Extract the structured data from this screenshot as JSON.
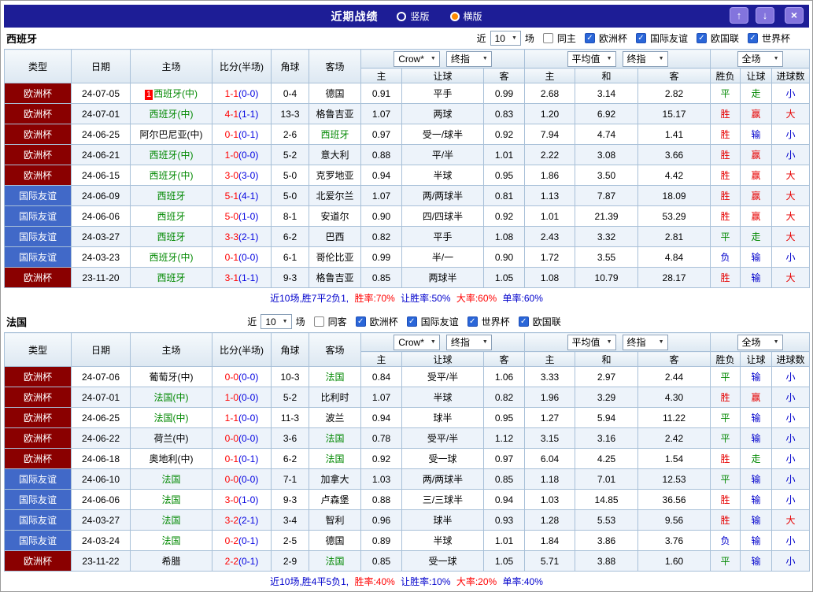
{
  "topbar": {
    "title": "近期战绩",
    "radio_vertical": "竖版",
    "radio_horizontal": "横版",
    "selected": "横版"
  },
  "icons": {
    "up_arrow": "↑",
    "down_arrow": "↓",
    "close": "×",
    "dropdown": "▼",
    "check": "✓"
  },
  "columns": {
    "type": "类型",
    "date": "日期",
    "home": "主场",
    "score": "比分(半场)",
    "corners": "角球",
    "away": "客场",
    "ah": {
      "bookmaker": "Crow*",
      "stage": "终指",
      "home": "主",
      "line": "让球",
      "away": "客"
    },
    "eu": {
      "label": "平均值",
      "stage": "终指",
      "home": "主",
      "draw": "和",
      "away": "客"
    },
    "result": {
      "label": "全场",
      "wdl": "胜负",
      "ah": "让球",
      "ou": "进球数"
    }
  },
  "type_styles": {
    "欧洲杯": "#8a0000",
    "国际友谊": "#4169c8"
  },
  "result_colors": {
    "胜": "#e60000",
    "平": "#008800",
    "负": "#0000cc",
    "赢": "#e60000",
    "走": "#008800",
    "输": "#0000cc",
    "大": "#e60000",
    "小": "#0000cc"
  },
  "sections": [
    {
      "team": "西班牙",
      "filter": {
        "prefix": "近",
        "count": "10",
        "suffix": "场",
        "same_label": "同主",
        "same_checked": false,
        "comps": [
          {
            "label": "欧洲杯",
            "checked": true
          },
          {
            "label": "国际友谊",
            "checked": true
          },
          {
            "label": "欧国联",
            "checked": true
          },
          {
            "label": "世界杯",
            "checked": true
          }
        ]
      },
      "rows": [
        {
          "type": "欧洲杯",
          "date": "24-07-05",
          "home": {
            "text": "西班牙(中)",
            "green": true,
            "badge": "1"
          },
          "score": "1-1",
          "half": "(0-0)",
          "corners": "0-4",
          "away": {
            "text": "德国"
          },
          "ah": [
            "0.91",
            "平手",
            "0.99"
          ],
          "eu": [
            "2.68",
            "3.14",
            "2.82"
          ],
          "res": [
            "平",
            "走",
            "小"
          ]
        },
        {
          "type": "欧洲杯",
          "date": "24-07-01",
          "home": {
            "text": "西班牙(中)",
            "green": true
          },
          "score": "4-1",
          "half": "(1-1)",
          "corners": "13-3",
          "away": {
            "text": "格鲁吉亚"
          },
          "ah": [
            "1.07",
            "两球",
            "0.83"
          ],
          "eu": [
            "1.20",
            "6.92",
            "15.17"
          ],
          "res": [
            "胜",
            "赢",
            "大"
          ]
        },
        {
          "type": "欧洲杯",
          "date": "24-06-25",
          "home": {
            "text": "阿尔巴尼亚(中)"
          },
          "score": "0-1",
          "half": "(0-1)",
          "corners": "2-6",
          "away": {
            "text": "西班牙",
            "green": true
          },
          "ah": [
            "0.97",
            "受一/球半",
            "0.92"
          ],
          "eu": [
            "7.94",
            "4.74",
            "1.41"
          ],
          "res": [
            "胜",
            "输",
            "小"
          ]
        },
        {
          "type": "欧洲杯",
          "date": "24-06-21",
          "home": {
            "text": "西班牙(中)",
            "green": true
          },
          "score": "1-0",
          "half": "(0-0)",
          "corners": "5-2",
          "away": {
            "text": "意大利"
          },
          "ah": [
            "0.88",
            "平/半",
            "1.01"
          ],
          "eu": [
            "2.22",
            "3.08",
            "3.66"
          ],
          "res": [
            "胜",
            "赢",
            "小"
          ]
        },
        {
          "type": "欧洲杯",
          "date": "24-06-15",
          "home": {
            "text": "西班牙(中)",
            "green": true
          },
          "score": "3-0",
          "half": "(3-0)",
          "corners": "5-0",
          "away": {
            "text": "克罗地亚"
          },
          "ah": [
            "0.94",
            "半球",
            "0.95"
          ],
          "eu": [
            "1.86",
            "3.50",
            "4.42"
          ],
          "res": [
            "胜",
            "赢",
            "大"
          ]
        },
        {
          "type": "国际友谊",
          "date": "24-06-09",
          "home": {
            "text": "西班牙",
            "green": true
          },
          "score": "5-1",
          "half": "(4-1)",
          "corners": "5-0",
          "away": {
            "text": "北爱尔兰"
          },
          "ah": [
            "1.07",
            "两/两球半",
            "0.81"
          ],
          "eu": [
            "1.13",
            "7.87",
            "18.09"
          ],
          "res": [
            "胜",
            "赢",
            "大"
          ]
        },
        {
          "type": "国际友谊",
          "date": "24-06-06",
          "home": {
            "text": "西班牙",
            "green": true
          },
          "score": "5-0",
          "half": "(1-0)",
          "corners": "8-1",
          "away": {
            "text": "安道尔"
          },
          "ah": [
            "0.90",
            "四/四球半",
            "0.92"
          ],
          "eu": [
            "1.01",
            "21.39",
            "53.29"
          ],
          "res": [
            "胜",
            "赢",
            "大"
          ]
        },
        {
          "type": "国际友谊",
          "date": "24-03-27",
          "home": {
            "text": "西班牙",
            "green": true
          },
          "score": "3-3",
          "half": "(2-1)",
          "corners": "6-2",
          "away": {
            "text": "巴西"
          },
          "ah": [
            "0.82",
            "平手",
            "1.08"
          ],
          "eu": [
            "2.43",
            "3.32",
            "2.81"
          ],
          "res": [
            "平",
            "走",
            "大"
          ]
        },
        {
          "type": "国际友谊",
          "date": "24-03-23",
          "home": {
            "text": "西班牙(中)",
            "green": true
          },
          "score": "0-1",
          "half": "(0-0)",
          "corners": "6-1",
          "away": {
            "text": "哥伦比亚"
          },
          "ah": [
            "0.99",
            "半/一",
            "0.90"
          ],
          "eu": [
            "1.72",
            "3.55",
            "4.84"
          ],
          "res": [
            "负",
            "输",
            "小"
          ]
        },
        {
          "type": "欧洲杯",
          "date": "23-11-20",
          "home": {
            "text": "西班牙",
            "green": true
          },
          "score": "3-1",
          "half": "(1-1)",
          "corners": "9-3",
          "away": {
            "text": "格鲁吉亚"
          },
          "ah": [
            "0.85",
            "两球半",
            "1.05"
          ],
          "eu": [
            "1.08",
            "10.79",
            "28.17"
          ],
          "res": [
            "胜",
            "输",
            "大"
          ]
        }
      ],
      "summary": [
        {
          "text": "近10场,胜7平2负1, ",
          "color": "#0000cc"
        },
        {
          "text": "胜率:70% ",
          "color": "#ff0000"
        },
        {
          "text": "让胜率:50% ",
          "color": "#0000cc"
        },
        {
          "text": "大率:60% ",
          "color": "#ff0000"
        },
        {
          "text": "单率:60%",
          "color": "#0000cc"
        }
      ]
    },
    {
      "team": "法国",
      "filter": {
        "prefix": "近",
        "count": "10",
        "suffix": "场",
        "same_label": "同客",
        "same_checked": false,
        "comps": [
          {
            "label": "欧洲杯",
            "checked": true
          },
          {
            "label": "国际友谊",
            "checked": true
          },
          {
            "label": "世界杯",
            "checked": true
          },
          {
            "label": "欧国联",
            "checked": true
          }
        ]
      },
      "rows": [
        {
          "type": "欧洲杯",
          "date": "24-07-06",
          "home": {
            "text": "葡萄牙(中)"
          },
          "score": "0-0",
          "half": "(0-0)",
          "corners": "10-3",
          "away": {
            "text": "法国",
            "green": true
          },
          "ah": [
            "0.84",
            "受平/半",
            "1.06"
          ],
          "eu": [
            "3.33",
            "2.97",
            "2.44"
          ],
          "res": [
            "平",
            "输",
            "小"
          ]
        },
        {
          "type": "欧洲杯",
          "date": "24-07-01",
          "home": {
            "text": "法国(中)",
            "green": true
          },
          "score": "1-0",
          "half": "(0-0)",
          "corners": "5-2",
          "away": {
            "text": "比利时"
          },
          "ah": [
            "1.07",
            "半球",
            "0.82"
          ],
          "eu": [
            "1.96",
            "3.29",
            "4.30"
          ],
          "res": [
            "胜",
            "赢",
            "小"
          ]
        },
        {
          "type": "欧洲杯",
          "date": "24-06-25",
          "home": {
            "text": "法国(中)",
            "green": true
          },
          "score": "1-1",
          "half": "(0-0)",
          "corners": "11-3",
          "away": {
            "text": "波兰"
          },
          "ah": [
            "0.94",
            "球半",
            "0.95"
          ],
          "eu": [
            "1.27",
            "5.94",
            "11.22"
          ],
          "res": [
            "平",
            "输",
            "小"
          ]
        },
        {
          "type": "欧洲杯",
          "date": "24-06-22",
          "home": {
            "text": "荷兰(中)"
          },
          "score": "0-0",
          "half": "(0-0)",
          "corners": "3-6",
          "away": {
            "text": "法国",
            "green": true
          },
          "ah": [
            "0.78",
            "受平/半",
            "1.12"
          ],
          "eu": [
            "3.15",
            "3.16",
            "2.42"
          ],
          "res": [
            "平",
            "输",
            "小"
          ]
        },
        {
          "type": "欧洲杯",
          "date": "24-06-18",
          "home": {
            "text": "奥地利(中)"
          },
          "score": "0-1",
          "half": "(0-1)",
          "corners": "6-2",
          "away": {
            "text": "法国",
            "green": true
          },
          "ah": [
            "0.92",
            "受一球",
            "0.97"
          ],
          "eu": [
            "6.04",
            "4.25",
            "1.54"
          ],
          "res": [
            "胜",
            "走",
            "小"
          ]
        },
        {
          "type": "国际友谊",
          "date": "24-06-10",
          "home": {
            "text": "法国",
            "green": true
          },
          "score": "0-0",
          "half": "(0-0)",
          "corners": "7-1",
          "away": {
            "text": "加拿大"
          },
          "ah": [
            "1.03",
            "两/两球半",
            "0.85"
          ],
          "eu": [
            "1.18",
            "7.01",
            "12.53"
          ],
          "res": [
            "平",
            "输",
            "小"
          ]
        },
        {
          "type": "国际友谊",
          "date": "24-06-06",
          "home": {
            "text": "法国",
            "green": true
          },
          "score": "3-0",
          "half": "(1-0)",
          "corners": "9-3",
          "away": {
            "text": "卢森堡"
          },
          "ah": [
            "0.88",
            "三/三球半",
            "0.94"
          ],
          "eu": [
            "1.03",
            "14.85",
            "36.56"
          ],
          "res": [
            "胜",
            "输",
            "小"
          ]
        },
        {
          "type": "国际友谊",
          "date": "24-03-27",
          "home": {
            "text": "法国",
            "green": true
          },
          "score": "3-2",
          "half": "(2-1)",
          "corners": "3-4",
          "away": {
            "text": "智利"
          },
          "ah": [
            "0.96",
            "球半",
            "0.93"
          ],
          "eu": [
            "1.28",
            "5.53",
            "9.56"
          ],
          "res": [
            "胜",
            "输",
            "大"
          ]
        },
        {
          "type": "国际友谊",
          "date": "24-03-24",
          "home": {
            "text": "法国",
            "green": true
          },
          "score": "0-2",
          "half": "(0-1)",
          "corners": "2-5",
          "away": {
            "text": "德国"
          },
          "ah": [
            "0.89",
            "半球",
            "1.01"
          ],
          "eu": [
            "1.84",
            "3.86",
            "3.76"
          ],
          "res": [
            "负",
            "输",
            "小"
          ]
        },
        {
          "type": "欧洲杯",
          "date": "23-11-22",
          "home": {
            "text": "希腊"
          },
          "score": "2-2",
          "half": "(0-1)",
          "corners": "2-9",
          "away": {
            "text": "法国",
            "green": true
          },
          "ah": [
            "0.85",
            "受一球",
            "1.05"
          ],
          "eu": [
            "5.71",
            "3.88",
            "1.60"
          ],
          "res": [
            "平",
            "输",
            "小"
          ]
        }
      ],
      "summary": [
        {
          "text": "近10场,胜4平5负1, ",
          "color": "#0000cc"
        },
        {
          "text": "胜率:40% ",
          "color": "#ff0000"
        },
        {
          "text": "让胜率:10% ",
          "color": "#0000cc"
        },
        {
          "text": "大率:20% ",
          "color": "#ff0000"
        },
        {
          "text": "单率:40%",
          "color": "#0000cc"
        }
      ]
    }
  ]
}
